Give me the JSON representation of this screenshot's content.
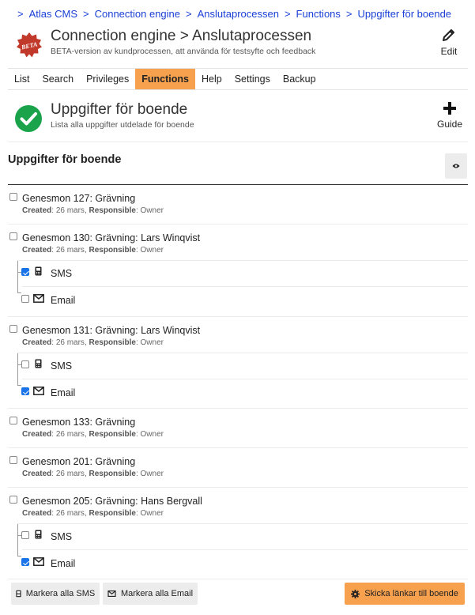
{
  "breadcrumb": {
    "prefix": ">",
    "items": [
      "Atlas CMS",
      "Connection engine",
      "Anslutaprocessen",
      "Functions",
      "Uppgifter för boende"
    ],
    "separator": ">"
  },
  "header": {
    "badge_text": "BETA",
    "title": "Connection engine > Anslutaprocessen",
    "subtitle": "BETA-version av kundprocessen, att använda för testsyfte och feedback",
    "edit_label": "Edit"
  },
  "tabs": [
    {
      "label": "List",
      "active": false
    },
    {
      "label": "Search",
      "active": false
    },
    {
      "label": "Privileges",
      "active": false
    },
    {
      "label": "Functions",
      "active": true
    },
    {
      "label": "Help",
      "active": false
    },
    {
      "label": "Settings",
      "active": false
    },
    {
      "label": "Backup",
      "active": false
    }
  ],
  "section": {
    "title": "Uppgifter för boende",
    "subtitle": "Lista alla uppgifter utdelade för boende",
    "guide_label": "Guide"
  },
  "list": {
    "heading": "Uppgifter för boende",
    "created_label": "Created",
    "responsible_label": "Responsible",
    "tasks": [
      {
        "title": "Genesmon 127: Grävning",
        "created": "26 mars",
        "responsible": "Owner",
        "checked": false,
        "subs": []
      },
      {
        "title": "Genesmon 130: Grävning: Lars Winqvist",
        "created": "26 mars",
        "responsible": "Owner",
        "checked": false,
        "subs": [
          {
            "label": "SMS",
            "icon": "phone-icon",
            "checked": true
          },
          {
            "label": "Email",
            "icon": "envelope-icon",
            "checked": false
          }
        ]
      },
      {
        "title": "Genesmon 131: Grävning: Lars Winqvist",
        "created": "26 mars",
        "responsible": "Owner",
        "checked": false,
        "subs": [
          {
            "label": "SMS",
            "icon": "phone-icon",
            "checked": false
          },
          {
            "label": "Email",
            "icon": "envelope-icon",
            "checked": true
          }
        ]
      },
      {
        "title": "Genesmon 133: Grävning",
        "created": "26 mars",
        "responsible": "Owner",
        "checked": false,
        "subs": []
      },
      {
        "title": "Genesmon 201: Grävning",
        "created": "26 mars",
        "responsible": "Owner",
        "checked": false,
        "subs": []
      },
      {
        "title": "Genesmon 205: Grävning: Hans Bergvall",
        "created": "26 mars",
        "responsible": "Owner",
        "checked": false,
        "subs": [
          {
            "label": "SMS",
            "icon": "phone-icon",
            "checked": false
          },
          {
            "label": "Email",
            "icon": "envelope-icon",
            "checked": true
          }
        ]
      }
    ]
  },
  "actions": {
    "mark_sms": "Markera alla SMS",
    "mark_email": "Markera alla Email",
    "send_links": "Skicka länkar till boende"
  },
  "colors": {
    "accent": "#f7a04e",
    "link": "#1a3fd6",
    "success": "#1aa34a",
    "beta_badge": "#c0392b",
    "checkbox": "#1a73e8"
  }
}
